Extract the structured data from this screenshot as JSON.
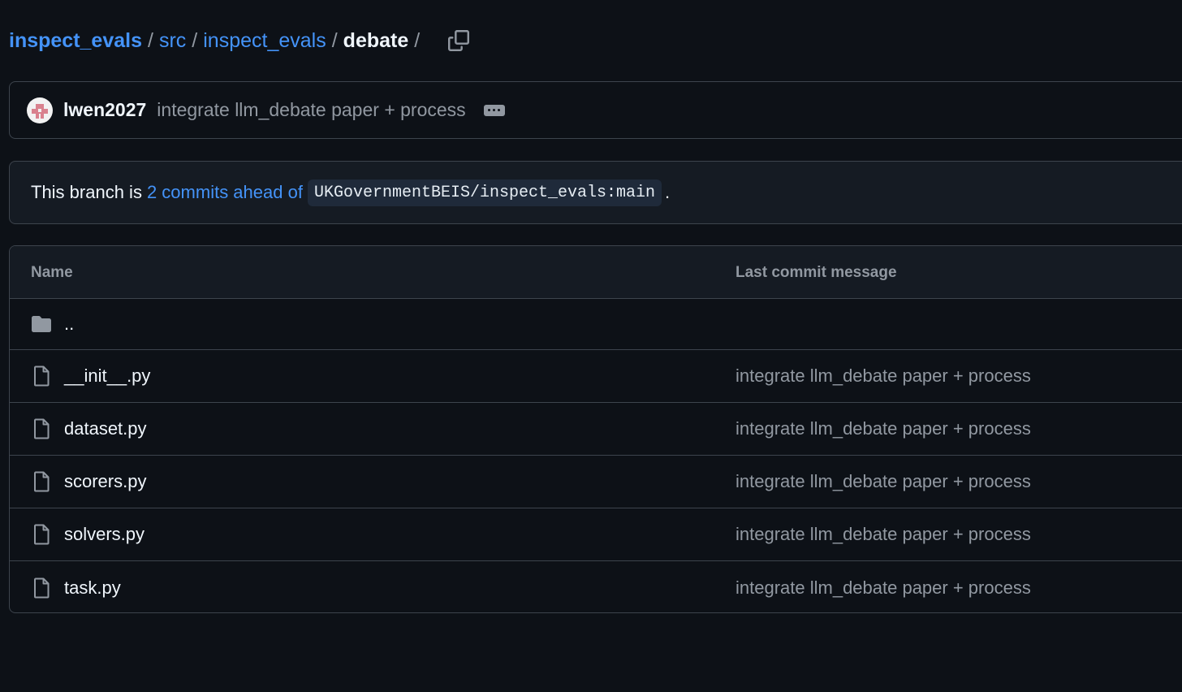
{
  "breadcrumb": {
    "repo": "inspect_evals",
    "sep1": "/",
    "dir1": "src",
    "sep2": "/",
    "dir2": "inspect_evals",
    "sep3": "/",
    "current": "debate",
    "sep4": "/"
  },
  "commit": {
    "author": "lwen2027",
    "message": "integrate llm_debate paper + process"
  },
  "branch": {
    "prefix": "This branch is",
    "link": "2 commits ahead of",
    "ref": "UKGovernmentBEIS/inspect_evals:main",
    "suffix": "."
  },
  "table": {
    "headers": {
      "name": "Name",
      "message": "Last commit message"
    },
    "parent": "..",
    "files": [
      {
        "name": "__init__.py",
        "message": "integrate llm_debate paper + process"
      },
      {
        "name": "dataset.py",
        "message": "integrate llm_debate paper + process"
      },
      {
        "name": "scorers.py",
        "message": "integrate llm_debate paper + process"
      },
      {
        "name": "solvers.py",
        "message": "integrate llm_debate paper + process"
      },
      {
        "name": "task.py",
        "message": "integrate llm_debate paper + process"
      }
    ]
  },
  "colors": {
    "background": "#0d1117",
    "link": "#4493f8",
    "muted": "#9198a1",
    "border": "#3d444d"
  },
  "icons": {
    "copy": "copy-icon",
    "folder": "folder-icon",
    "file": "file-icon",
    "avatar": "identicon-avatar",
    "ellipsis": "ellipsis-icon"
  }
}
